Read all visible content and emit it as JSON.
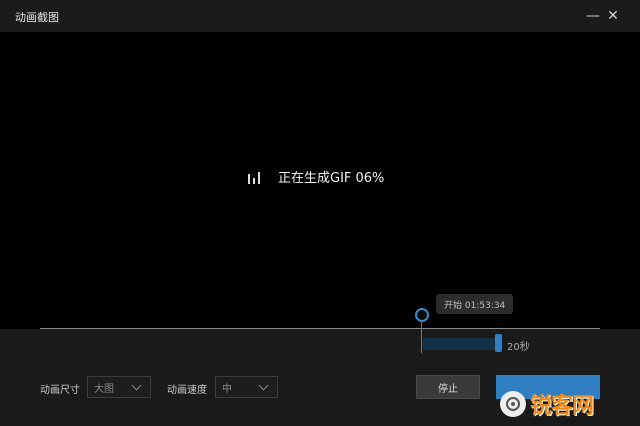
{
  "window": {
    "title": "动画截图",
    "minimize_glyph": "—",
    "close_glyph": "✕"
  },
  "preview": {
    "status_text": "正在生成GIF  06%",
    "progress_percent": 6
  },
  "timeline": {
    "start_tooltip": "开始 01:53:34",
    "duration": "20秒"
  },
  "settings": {
    "size_label": "动画尺寸",
    "size_value": "大图",
    "speed_label": "动画速度",
    "speed_value": "中"
  },
  "actions": {
    "stop_label": "停止"
  },
  "watermark": {
    "text": "锐客网"
  },
  "colors": {
    "accent": "#2f7fc1",
    "background": "#000000",
    "panel": "#1a1a1a"
  }
}
